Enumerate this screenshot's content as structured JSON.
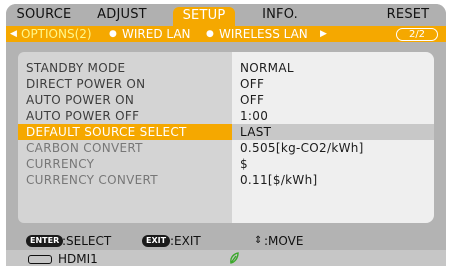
{
  "tabs": [
    {
      "label": "SOURCE",
      "active": false
    },
    {
      "label": "ADJUST",
      "active": false
    },
    {
      "label": "SETUP",
      "active": true
    },
    {
      "label": "INFO.",
      "active": false
    },
    {
      "label": "RESET",
      "active": false
    }
  ],
  "subtabs": [
    {
      "label": "OPTIONS(2)",
      "active": true
    },
    {
      "label": "WIRED LAN",
      "active": false
    },
    {
      "label": "WIRELESS LAN",
      "active": false
    }
  ],
  "pager": "2/2",
  "rows": [
    {
      "label": "STANDBY MODE",
      "value": "NORMAL",
      "state": "normal"
    },
    {
      "label": "DIRECT POWER ON",
      "value": "OFF",
      "state": "normal"
    },
    {
      "label": "AUTO POWER ON",
      "value": "OFF",
      "state": "normal"
    },
    {
      "label": "AUTO POWER OFF",
      "value": "1:00",
      "state": "normal"
    },
    {
      "label": "DEFAULT SOURCE SELECT",
      "value": "LAST",
      "state": "selected"
    },
    {
      "label": "CARBON CONVERT",
      "value": "0.505[kg-CO2/kWh]",
      "state": "disabled"
    },
    {
      "label": "CURRENCY",
      "value": "$",
      "state": "disabled"
    },
    {
      "label": "CURRENCY CONVERT",
      "value": "0.11[$/kWh]",
      "state": "disabled"
    }
  ],
  "footer": {
    "enter_key": "ENTER",
    "enter_text": ":SELECT",
    "exit_key": "EXIT",
    "exit_text": ":EXIT",
    "move_icon": "⇕",
    "move_text": ":MOVE"
  },
  "status": {
    "input_icon": "hdmi-connector-icon",
    "input_label": "HDMI1",
    "eco_icon": "leaf-icon",
    "eco_color": "#3aa82a"
  },
  "colors": {
    "accent": "#f5a800",
    "menu_background": "#b3b3b3",
    "value_panel": "#efefef"
  }
}
